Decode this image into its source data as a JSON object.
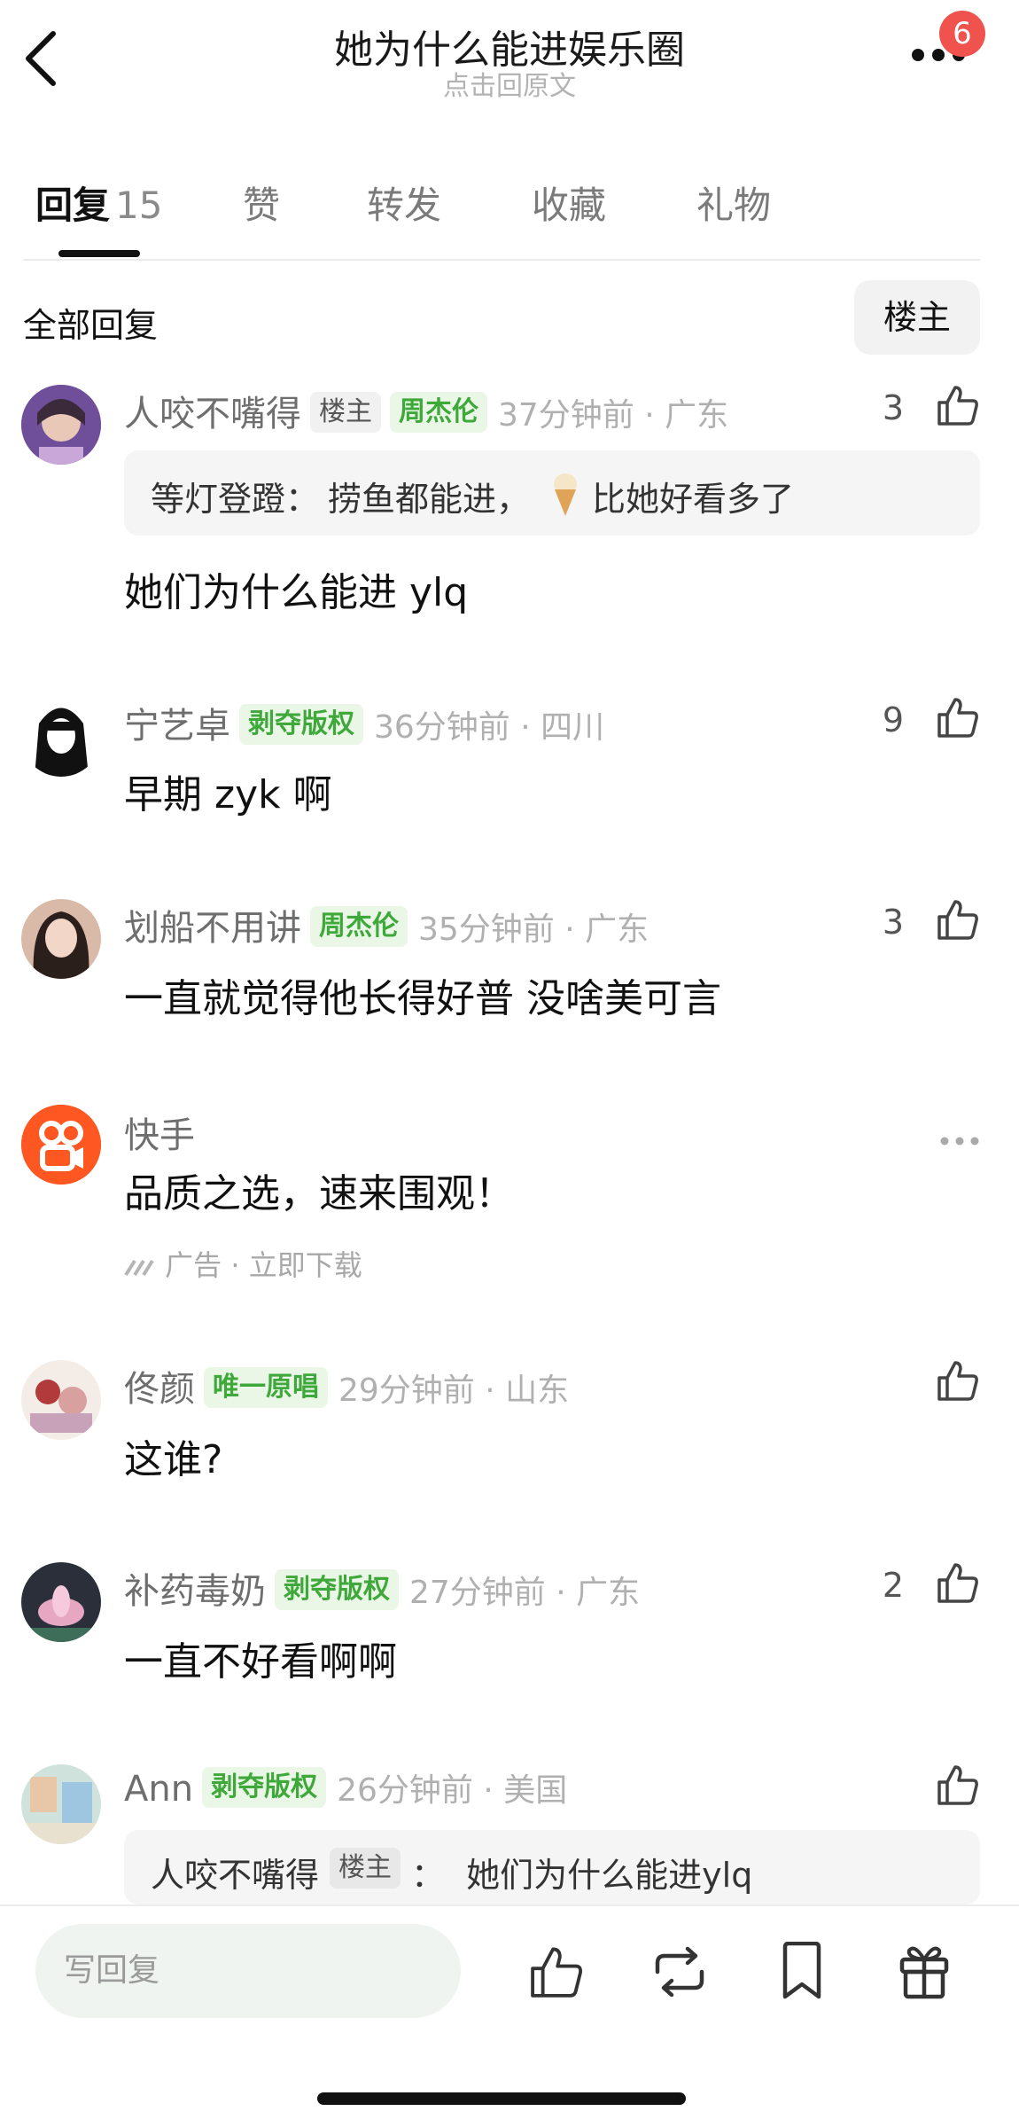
{
  "header": {
    "title": "她为什么能进娱乐圈",
    "subtitle": "点击回原文",
    "badge_count": "6",
    "icons": {
      "back": "chevron-left-icon",
      "more": "more-dots-icon"
    }
  },
  "tabs": [
    {
      "label": "回复",
      "count": "15"
    },
    {
      "label": "赞"
    },
    {
      "label": "转发"
    },
    {
      "label": "收藏"
    },
    {
      "label": "礼物"
    }
  ],
  "section": {
    "title": "全部回复",
    "filter_label": "楼主"
  },
  "comments": [
    {
      "user": "人咬不嘴得",
      "tags": [
        "楼主",
        "周杰伦"
      ],
      "meta": "37分钟前 · 广东",
      "likes": "3",
      "quote": {
        "author": "等灯登蹬：",
        "text": "捞鱼都能进，",
        "after": "比她好看多了"
      },
      "text": "她们为什么能进 ylq"
    },
    {
      "user": "宁艺卓",
      "tags": [
        "剥夺版权"
      ],
      "meta": "36分钟前 · 四川",
      "likes": "9",
      "text": "早期 zyk 啊"
    },
    {
      "user": "划船不用讲",
      "tags": [
        "周杰伦"
      ],
      "meta": "35分钟前 · 广东",
      "likes": "3",
      "text": "一直就觉得他长得好普 没啥美可言"
    },
    {
      "ad": true,
      "user": "快手",
      "text": "品质之选，速来围观！",
      "footer": "广告 · 立即下载"
    },
    {
      "user": "佟颜",
      "tags": [
        "唯一原唱"
      ],
      "meta": "29分钟前 · 山东",
      "likes": "",
      "text": "这谁?"
    },
    {
      "user": "补药毒奶",
      "tags": [
        "剥夺版权"
      ],
      "meta": "27分钟前 · 广东",
      "likes": "2",
      "text": "一直不好看啊啊"
    },
    {
      "user": "Ann",
      "tags": [
        "剥夺版权"
      ],
      "meta": "26分钟前 · 美国",
      "likes": "",
      "quote": {
        "author": "人咬不嘴得",
        "tag": "楼主",
        "text": "：  她们为什么能进ylq"
      }
    }
  ],
  "bottom_bar": {
    "reply_placeholder": "写回复",
    "icons": [
      "thumb-up-icon",
      "repost-icon",
      "bookmark-icon",
      "gift-icon"
    ]
  },
  "colors": {
    "accent_green": "#3fa83a",
    "badge_red": "#f0524d",
    "ad_brand": "#ff5722"
  }
}
